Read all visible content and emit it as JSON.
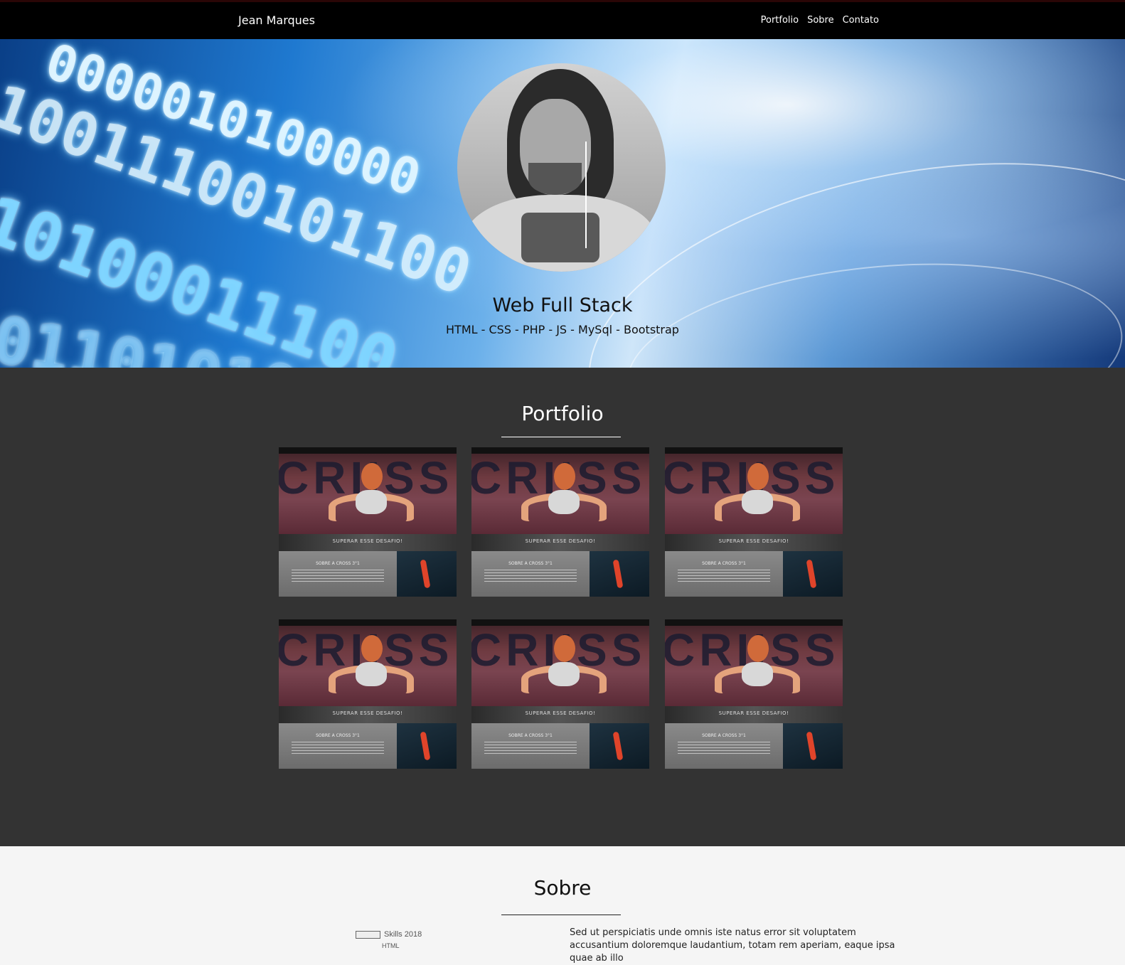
{
  "navbar": {
    "brand": "Jean Marques",
    "links": [
      "Portfolio",
      "Sobre",
      "Contato"
    ]
  },
  "hero": {
    "title": "Web Full Stack",
    "subtitle": "HTML - CSS - PHP - JS - MySql - Bootstrap"
  },
  "portfolio": {
    "title": "Portfolio",
    "items": [
      {
        "banner": "SUPERAR ESSE DESAFIO!",
        "section": "SOBRE A CROSS 3°1"
      },
      {
        "banner": "SUPERAR ESSE DESAFIO!",
        "section": "SOBRE A CROSS 3°1"
      },
      {
        "banner": "SUPERAR ESSE DESAFIO!",
        "section": "SOBRE A CROSS 3°1"
      },
      {
        "banner": "SUPERAR ESSE DESAFIO!",
        "section": "SOBRE A CROSS 3°1"
      },
      {
        "banner": "SUPERAR ESSE DESAFIO!",
        "section": "SOBRE A CROSS 3°1"
      },
      {
        "banner": "SUPERAR ESSE DESAFIO!",
        "section": "SOBRE A CROSS 3°1"
      }
    ]
  },
  "sobre": {
    "title": "Sobre",
    "skills_label": "Skills 2018",
    "skills_first": "HTML",
    "text": "Sed ut perspiciatis unde omnis iste natus error sit voluptatem accusantium doloremque laudantium, totam rem aperiam, eaque ipsa quae ab illo"
  },
  "colors": {
    "navbar_bg": "#000000",
    "portfolio_bg": "#333333",
    "sobre_bg": "#f5f5f5"
  }
}
